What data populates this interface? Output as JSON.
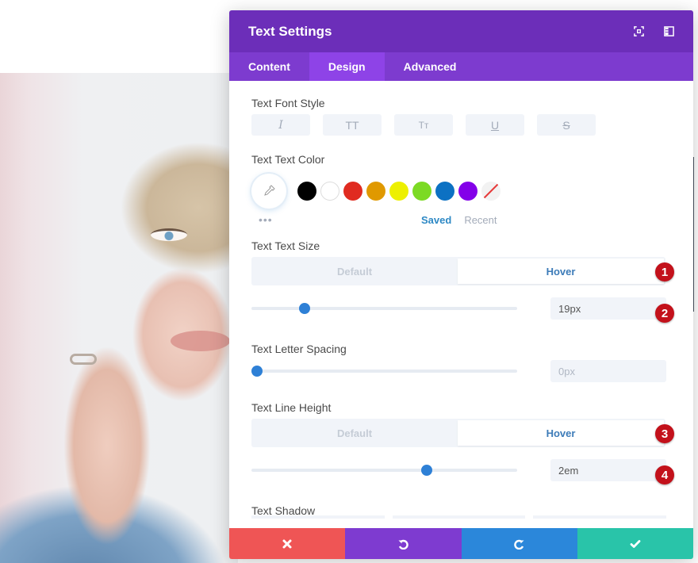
{
  "modal": {
    "title": "Text Settings",
    "header_icons": [
      "fullscreen-icon",
      "split-view-icon"
    ],
    "tabs": [
      {
        "label": "Content",
        "active": false
      },
      {
        "label": "Design",
        "active": true
      },
      {
        "label": "Advanced",
        "active": false
      }
    ],
    "font_style": {
      "label": "Text Font Style",
      "buttons": [
        {
          "glyph": "I",
          "name": "italic"
        },
        {
          "glyph": "TT",
          "name": "uppercase"
        },
        {
          "glyph": "Tт",
          "name": "capitalize"
        },
        {
          "glyph": "U",
          "name": "underline"
        },
        {
          "glyph": "S",
          "name": "strikethrough"
        }
      ]
    },
    "text_color": {
      "label": "Text Text Color",
      "swatches": [
        "#000000",
        "#ffffff",
        "#e02b20",
        "#e09900",
        "#edf000",
        "#7cda24",
        "#0c71c3",
        "#8300e9",
        "none"
      ],
      "more": "•••",
      "saved_label": "Saved",
      "recent_label": "Recent"
    },
    "text_size": {
      "label": "Text Text Size",
      "default_label": "Default",
      "hover_label": "Hover",
      "value": "19px",
      "slider_fraction": 0.2
    },
    "letter_spacing": {
      "label": "Text Letter Spacing",
      "value": "0px",
      "slider_fraction": 0.02
    },
    "line_height": {
      "label": "Text Line Height",
      "default_label": "Default",
      "hover_label": "Hover",
      "value": "2em",
      "slider_fraction": 0.66
    },
    "text_shadow": {
      "label": "Text Shadow"
    },
    "badges": [
      "1",
      "2",
      "3",
      "4"
    ],
    "footer": [
      {
        "name": "cancel",
        "color": "#ef5555"
      },
      {
        "name": "undo",
        "color": "#7e3bd0"
      },
      {
        "name": "redo",
        "color": "#2b87da"
      },
      {
        "name": "save",
        "color": "#29c4a9"
      }
    ]
  },
  "colors": {
    "header_bg": "#6c2eb9",
    "tabs_bg": "#7d3bcf",
    "tab_active_bg": "#8e43e7",
    "accent_blue": "#2e80d6",
    "badge_red": "#c3111b"
  }
}
